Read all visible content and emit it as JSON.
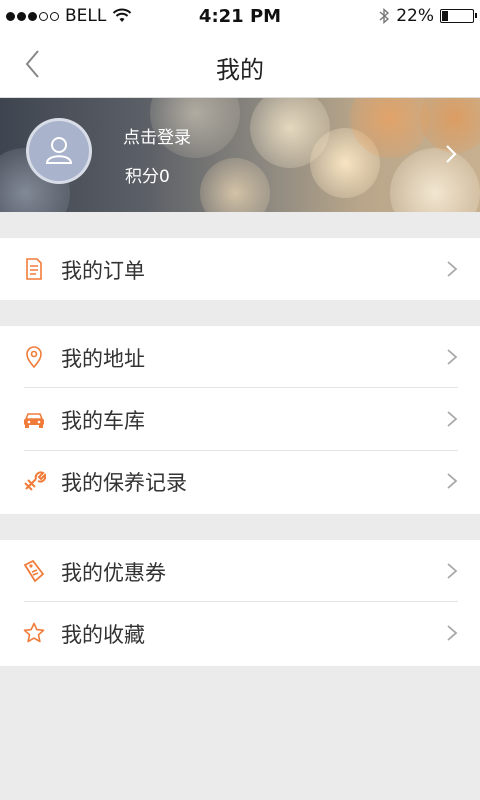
{
  "status_bar": {
    "carrier": "BELL",
    "time": "4:21 PM",
    "battery_text": "22%",
    "battery_level": 0.22,
    "signal_filled": 3,
    "signal_total": 5
  },
  "nav": {
    "title": "我的",
    "back_icon": "chevron-left-icon"
  },
  "profile": {
    "login_label": "点击登录",
    "points_label": "积分0",
    "avatar_icon": "user-icon"
  },
  "menu": {
    "orders": {
      "label": "我的订单",
      "icon": "document-icon"
    },
    "address": {
      "label": "我的地址",
      "icon": "location-pin-icon"
    },
    "garage": {
      "label": "我的车库",
      "icon": "car-icon"
    },
    "maintenance": {
      "label": "我的保养记录",
      "icon": "wrench-icon"
    },
    "coupons": {
      "label": "我的优惠券",
      "icon": "coupon-tag-icon"
    },
    "favorites": {
      "label": "我的收藏",
      "icon": "star-icon"
    }
  },
  "colors": {
    "accent": "#f07c3a",
    "chevron": "#a8a8a8",
    "background": "#ebebeb"
  }
}
